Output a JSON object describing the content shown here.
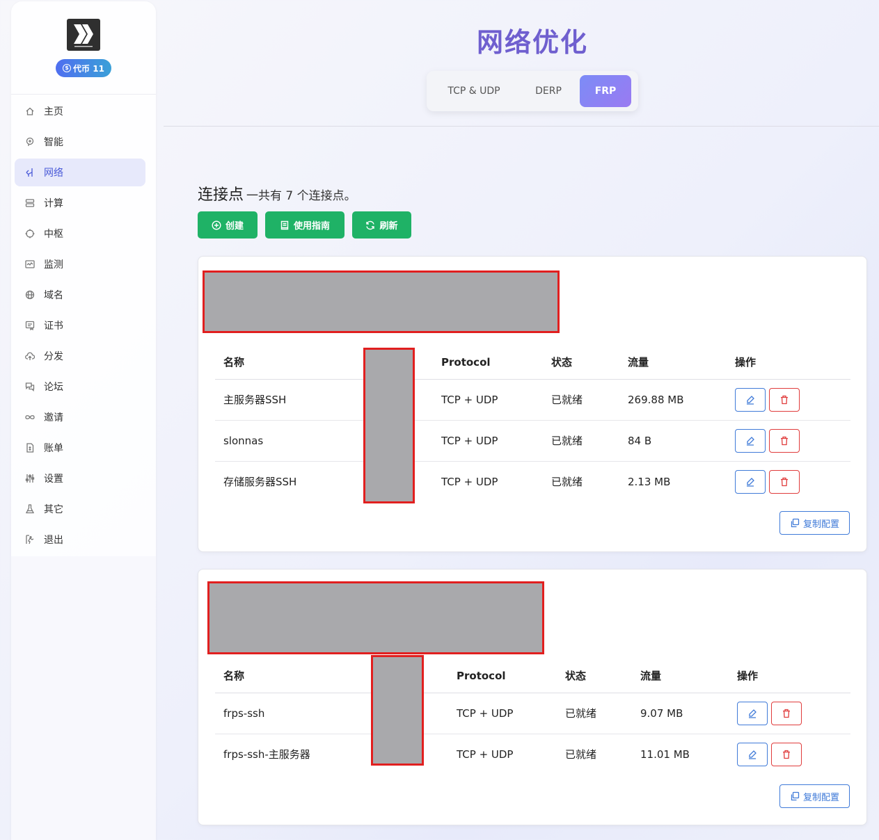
{
  "sidebar": {
    "coin_label": "代币 11",
    "coin_icon": "$",
    "items": [
      {
        "label": "主页",
        "icon": "home-icon"
      },
      {
        "label": "智能",
        "icon": "brain-icon"
      },
      {
        "label": "网络",
        "icon": "network-icon",
        "active": true
      },
      {
        "label": "计算",
        "icon": "server-icon"
      },
      {
        "label": "中枢",
        "icon": "hub-icon"
      },
      {
        "label": "监测",
        "icon": "monitor-icon"
      },
      {
        "label": "域名",
        "icon": "globe-icon"
      },
      {
        "label": "证书",
        "icon": "certificate-icon"
      },
      {
        "label": "分发",
        "icon": "cloud-upload-icon"
      },
      {
        "label": "论坛",
        "icon": "chat-icon"
      },
      {
        "label": "邀请",
        "icon": "infinity-icon"
      },
      {
        "label": "账单",
        "icon": "bill-icon"
      },
      {
        "label": "设置",
        "icon": "sliders-icon"
      },
      {
        "label": "其它",
        "icon": "flask-icon"
      },
      {
        "label": "退出",
        "icon": "exit-icon"
      }
    ]
  },
  "header": {
    "title": "网络优化",
    "tabs": [
      "TCP & UDP",
      "DERP",
      "FRP"
    ],
    "active_tab": "FRP"
  },
  "section": {
    "title": "连接点",
    "subtitle": "一共有 7 个连接点。",
    "buttons": {
      "create": "创建",
      "guide": "使用指南",
      "refresh": "刷新"
    }
  },
  "table_headers": {
    "name": "名称",
    "protocol": "Protocol",
    "status": "状态",
    "traffic": "流量",
    "actions": "操作"
  },
  "cards": [
    {
      "rows": [
        {
          "name": "主服务器SSH",
          "protocol": "TCP + UDP",
          "status": "已就绪",
          "traffic": "269.88 MB"
        },
        {
          "name": "slonnas",
          "protocol": "TCP + UDP",
          "status": "已就绪",
          "traffic": "84 B"
        },
        {
          "name": "存储服务器SSH",
          "protocol": "TCP + UDP",
          "status": "已就绪",
          "traffic": "2.13 MB"
        }
      ],
      "copy_label": "复制配置"
    },
    {
      "rows": [
        {
          "name": "frps-ssh",
          "protocol": "TCP + UDP",
          "status": "已就绪",
          "traffic": "9.07 MB"
        },
        {
          "name": "frps-ssh-主服务器",
          "protocol": "TCP + UDP",
          "status": "已就绪",
          "traffic": "11.01 MB"
        }
      ],
      "copy_label": "复制配置"
    }
  ],
  "colors": {
    "accent": "#6f5fcf",
    "green": "#1fb266",
    "ready": "#1fa85a",
    "edit": "#3f7ad8",
    "delete": "#e03b3b"
  }
}
